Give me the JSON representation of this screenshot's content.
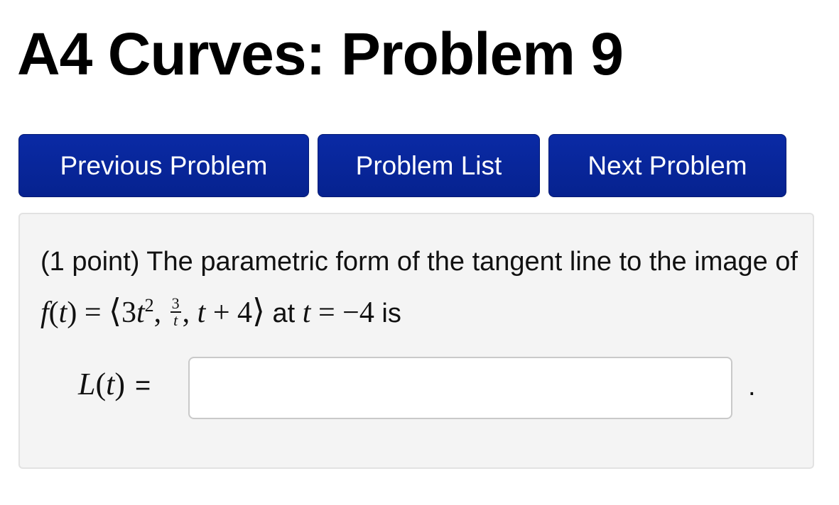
{
  "header": {
    "title": "A4 Curves: Problem 9"
  },
  "nav": {
    "previous_label": "Previous Problem",
    "list_label": "Problem List",
    "next_label": "Next Problem"
  },
  "problem": {
    "points": "(1 point)",
    "intro": "The parametric form of the tangent line to the image of",
    "function_name": "f",
    "variable": "t",
    "component1_coef": "3",
    "component1_exp": "2",
    "component2_num": "3",
    "component2_den": "t",
    "component3_const": "4",
    "at_word": "at",
    "t_value": "−4",
    "is_word": "is"
  },
  "answer": {
    "label_fn": "L",
    "label_var": "t",
    "equals": "=",
    "value": "",
    "placeholder": "",
    "trailing": "."
  },
  "colors": {
    "button_bg": "#0a2aa5",
    "box_bg": "#f4f4f4"
  }
}
